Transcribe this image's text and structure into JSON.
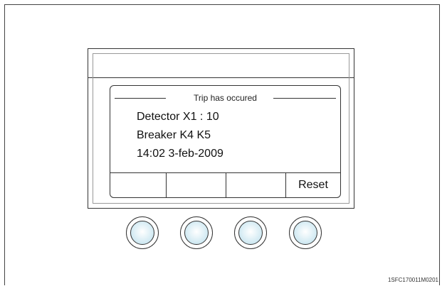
{
  "display": {
    "title": "Trip has occured",
    "lines": [
      "Detector X1 : 10",
      "Breaker K4 K5",
      "14:02  3-feb-2009"
    ],
    "softkeys": [
      "",
      "",
      "",
      "Reset"
    ]
  },
  "buttons_count": 4,
  "figure_code": "1SFC170011M0201",
  "colors": {
    "button_fill": "#c9e4ee",
    "outline": "#333333"
  }
}
